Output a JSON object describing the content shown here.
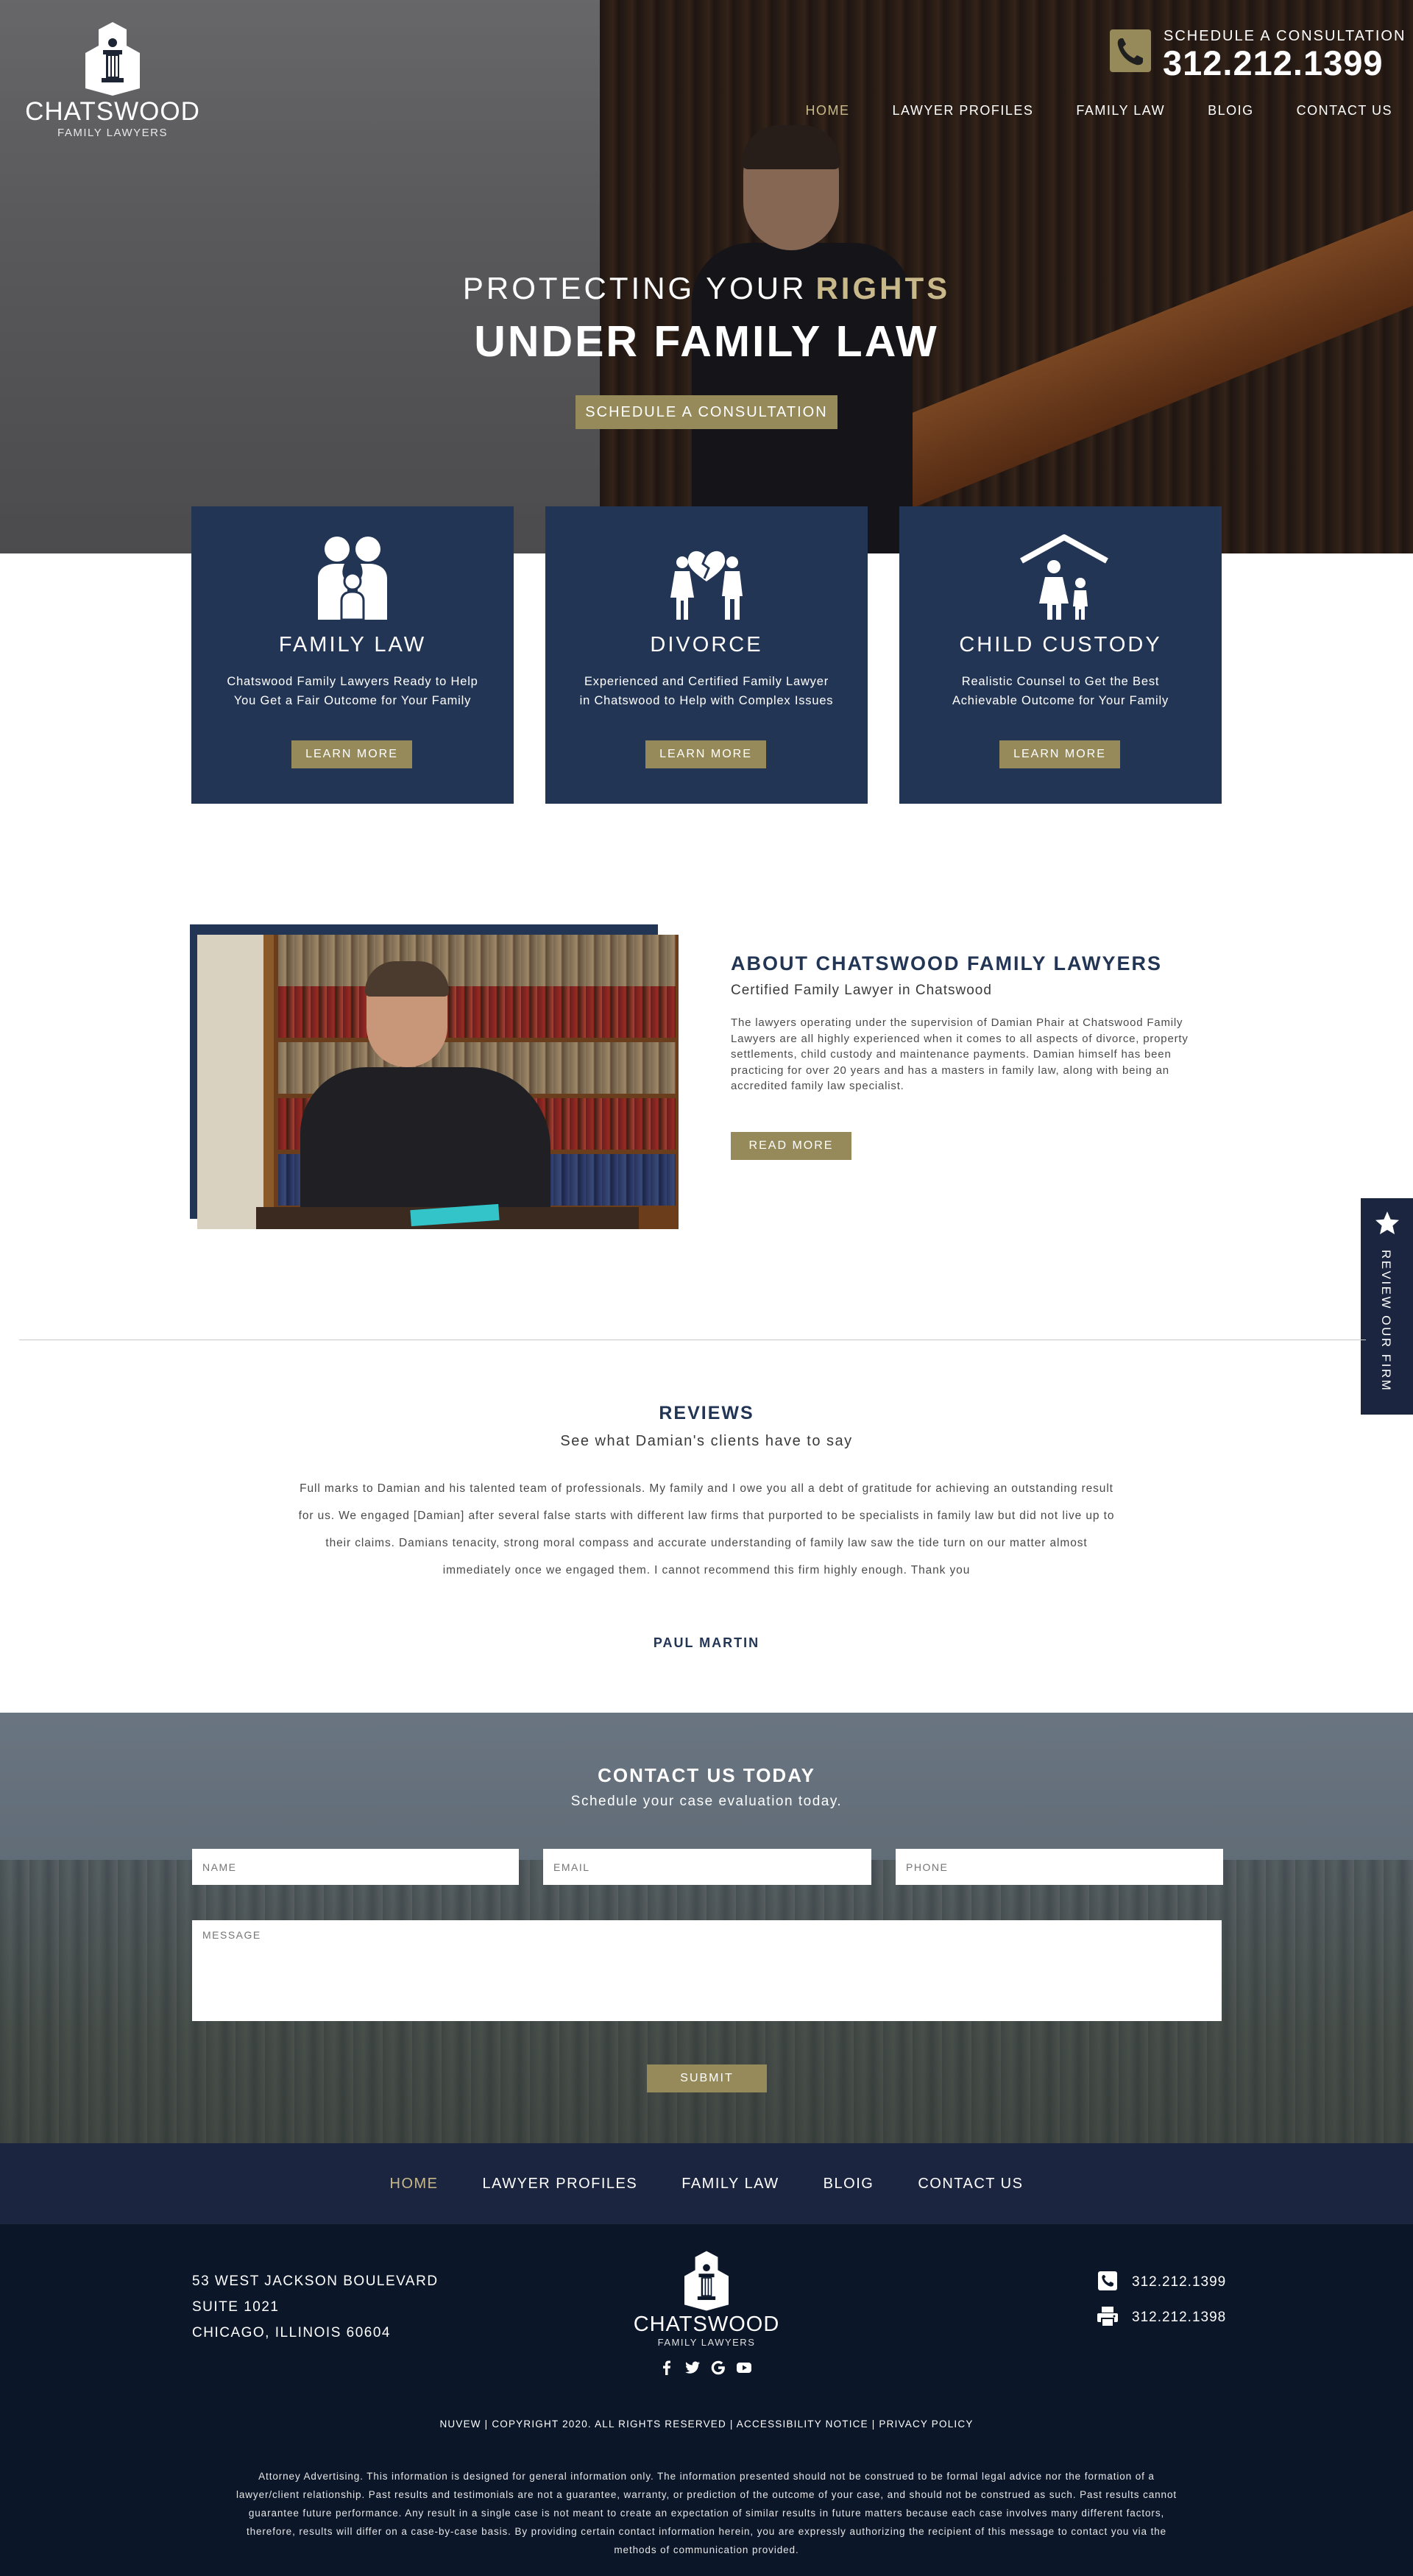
{
  "brand": {
    "name": "CHATSWOOD",
    "tagline": "FAMILY LAWYERS"
  },
  "header": {
    "schedule_label": "SCHEDULE A CONSULTATION",
    "phone": "312.212.1399",
    "phone_icon": "phone-icon",
    "nav": [
      {
        "label": "HOME",
        "active": true
      },
      {
        "label": "LAWYER PROFILES",
        "active": false
      },
      {
        "label": "FAMILY LAW",
        "active": false
      },
      {
        "label": "BLOIG",
        "active": false
      },
      {
        "label": "CONTACT US",
        "active": false
      }
    ]
  },
  "hero": {
    "line1": "PROTECTING YOUR",
    "line1_highlight": "RIGHTS",
    "line2": "UNDER FAMILY LAW",
    "cta": "SCHEDULE A CONSULTATION"
  },
  "services": [
    {
      "icon": "family-icon",
      "title": "FAMILY LAW",
      "desc_line1": "Chatswood Family Lawyers Ready to Help",
      "desc_line2": "You Get a Fair Outcome for Your Family",
      "button": "LEARN MORE"
    },
    {
      "icon": "broken-heart-icon",
      "title": "DIVORCE",
      "desc_line1": "Experienced and Certified Family Lawyer",
      "desc_line2": "in Chatswood to Help with Complex Issues",
      "button": "LEARN MORE"
    },
    {
      "icon": "house-parent-child-icon",
      "title": "CHILD CUSTODY",
      "desc_line1": "Realistic Counsel to Get the Best",
      "desc_line2": "Achievable Outcome for Your Family",
      "button": "LEARN MORE"
    }
  ],
  "about": {
    "title": "ABOUT CHATSWOOD FAMILY LAWYERS",
    "subtitle": "Certified Family Lawyer in Chatswood",
    "body": "The lawyers operating under the supervision of Damian Phair at Chatswood Family Lawyers are all highly experienced when it comes to all aspects of divorce, property settlements, child custody and maintenance payments. Damian himself has been practicing for over 20 years and has a masters in family law, along with being an accredited family law specialist.",
    "button": "READ MORE"
  },
  "review_tab": {
    "label": "REVIEW OUR FIRM",
    "icon": "star-icon"
  },
  "reviews": {
    "title": "REVIEWS",
    "subtitle": "See what Damian's clients have to say",
    "quote": "Full marks to Damian and his talented team of professionals. My family and I owe you all a debt of gratitude for achieving an outstanding result for us. We engaged [Damian] after several false starts with different law firms that purported to be specialists in family law but did not live up to their claims. Damians tenacity, strong moral compass and accurate understanding of family law saw the tide turn on our matter almost immediately once we engaged them. I cannot recommend this firm highly enough. Thank you",
    "author": "PAUL MARTIN"
  },
  "contact": {
    "title": "CONTACT US TODAY",
    "subtitle": "Schedule your case evaluation today.",
    "name_placeholder": "NAME",
    "email_placeholder": "EMAIL",
    "phone_placeholder": "PHONE",
    "message_placeholder": "MESSAGE",
    "submit": "SUBMIT"
  },
  "footer_nav": [
    {
      "label": "HOME",
      "active": true
    },
    {
      "label": "LAWYER PROFILES",
      "active": false
    },
    {
      "label": "FAMILY LAW",
      "active": false
    },
    {
      "label": "BLOIG",
      "active": false
    },
    {
      "label": "CONTACT US",
      "active": false
    }
  ],
  "footer": {
    "address_line1": "53 WEST JACKSON BOULEVARD",
    "address_line2": "SUITE 1021",
    "address_line3": "CHICAGO, ILLINOIS 60604",
    "phone": "312.212.1399",
    "fax": "312.212.1398",
    "social_icons": [
      "facebook-icon",
      "twitter-icon",
      "google-icon",
      "youtube-icon"
    ],
    "copyright": "NUVEW | COPYRIGHT 2020. ALL RIGHTS RESERVED | ACCESSIBILITY NOTICE | PRIVACY POLICY",
    "disclaimer": "Attorney Advertising. This information is designed for general information only. The information presented should not be construed to be formal legal advice nor the formation of a lawyer/client relationship. Past results and testimonials are not a guarantee, warranty, or prediction of the outcome of your case, and should not be construed as such. Past results cannot guarantee future performance. Any result in a single case is not meant to create an expectation of similar results in future matters because each case involves many different factors, therefore, results will differ on a case-by-case basis. By providing certain contact information herein, you are expressly authorizing the recipient of this message to contact you via the methods of communication provided."
  },
  "colors": {
    "navy": "#233554",
    "dark_navy": "#1b2540",
    "footer_bg": "#0b1629",
    "gold": "#968a5a",
    "gold_text": "#c9b98a"
  }
}
